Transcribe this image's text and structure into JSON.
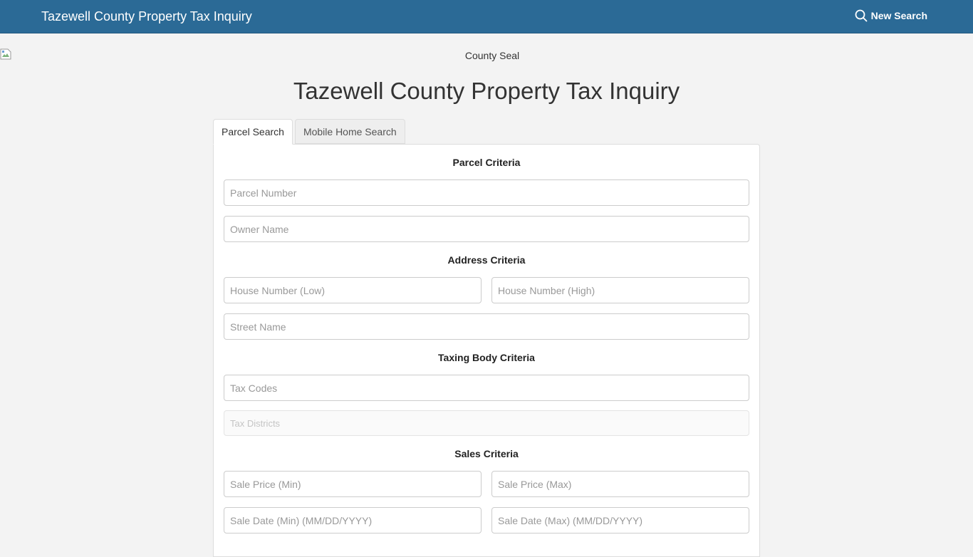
{
  "navbar": {
    "brand": "Tazewell County Property Tax Inquiry",
    "new_search_label": "New Search",
    "new_search_icon": "search-icon",
    "background_color": "#2b6a96"
  },
  "seal": {
    "alt_text": "County Seal"
  },
  "page_title": "Tazewell County Property Tax Inquiry",
  "tabs": [
    {
      "label": "Parcel Search",
      "active": true
    },
    {
      "label": "Mobile Home Search",
      "active": false
    }
  ],
  "sections": {
    "parcel": {
      "label": "Parcel Criteria",
      "parcel_number_placeholder": "Parcel Number",
      "owner_name_placeholder": "Owner Name"
    },
    "address": {
      "label": "Address Criteria",
      "house_low_placeholder": "House Number (Low)",
      "house_high_placeholder": "House Number (High)",
      "street_name_placeholder": "Street Name"
    },
    "taxing_body": {
      "label": "Taxing Body Criteria",
      "tax_codes_placeholder": "Tax Codes",
      "tax_districts_placeholder": "Tax Districts"
    },
    "sales": {
      "label": "Sales Criteria",
      "price_min_placeholder": "Sale Price (Min)",
      "price_max_placeholder": "Sale Price (Max)",
      "date_min_placeholder": "Sale Date (Min) (MM/DD/YYYY)",
      "date_max_placeholder": "Sale Date (Max) (MM/DD/YYYY)"
    }
  }
}
